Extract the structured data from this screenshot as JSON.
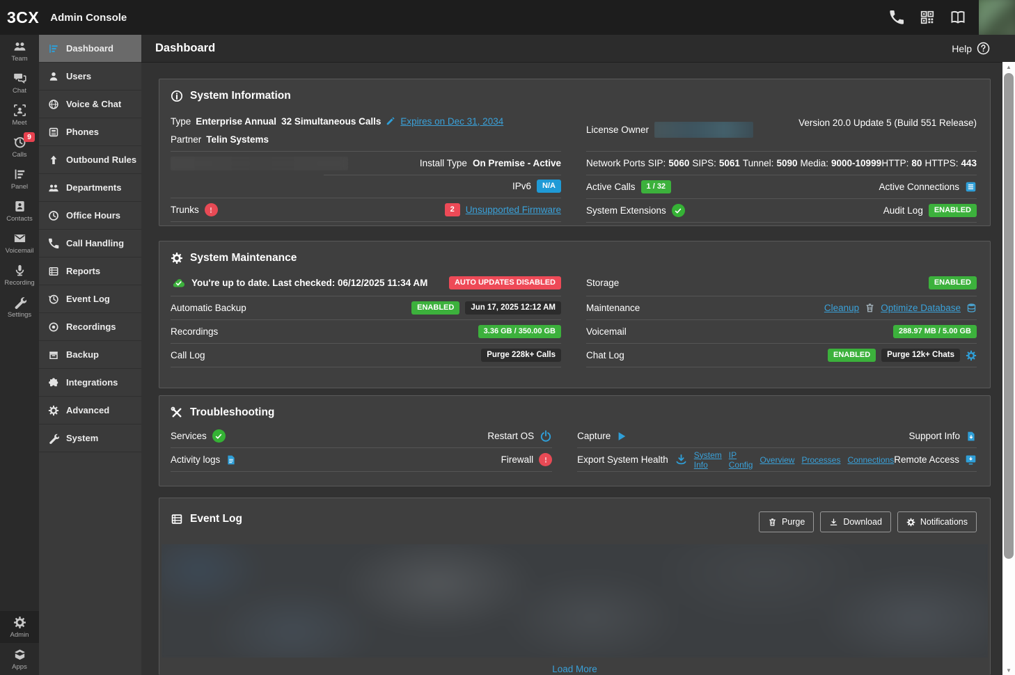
{
  "topbar": {
    "logo": "3CX",
    "title": "Admin Console"
  },
  "header": {
    "title": "Dashboard",
    "help": "Help"
  },
  "rail": {
    "items": [
      {
        "label": "Team"
      },
      {
        "label": "Chat"
      },
      {
        "label": "Meet"
      },
      {
        "label": "Calls",
        "badge": "9"
      },
      {
        "label": "Panel"
      },
      {
        "label": "Contacts"
      },
      {
        "label": "Voicemail"
      },
      {
        "label": "Recording"
      },
      {
        "label": "Settings"
      }
    ],
    "bottom": [
      {
        "label": "Admin"
      },
      {
        "label": "Apps"
      }
    ]
  },
  "sidebar": {
    "items": [
      {
        "label": "Dashboard"
      },
      {
        "label": "Users"
      },
      {
        "label": "Voice & Chat"
      },
      {
        "label": "Phones"
      },
      {
        "label": "Outbound Rules"
      },
      {
        "label": "Departments"
      },
      {
        "label": "Office Hours"
      },
      {
        "label": "Call Handling"
      },
      {
        "label": "Reports"
      },
      {
        "label": "Event Log"
      },
      {
        "label": "Recordings"
      },
      {
        "label": "Backup"
      },
      {
        "label": "Integrations"
      },
      {
        "label": "Advanced"
      },
      {
        "label": "System"
      }
    ]
  },
  "system_info": {
    "title": "System Information",
    "type_label": "Type",
    "type_value": "Enterprise Annual",
    "calls_value": "32 Simultaneous Calls",
    "expires_link": "Expires on Dec 31, 2034",
    "partner_label": "Partner",
    "partner_value": "Telin Systems",
    "install_label": "Install Type",
    "install_value": "On Premise - Active",
    "ipv6_label": "IPv6",
    "ipv6_badge": "N/A",
    "trunks_label": "Trunks",
    "trunks_count": "2",
    "trunks_link": "Unsupported Firmware",
    "license_owner_label": "License Owner",
    "version": "Version 20.0 Update 5 (Build 551 Release)",
    "ports_label": "Network Ports",
    "sip_label": "SIP:",
    "sip_value": "5060",
    "sips_label": "SIPS:",
    "sips_value": "5061",
    "tunnel_label": "Tunnel:",
    "tunnel_value": "5090",
    "media_label": "Media:",
    "media_value": "9000-10999",
    "http_label": "HTTP:",
    "http_value": "80",
    "https_label": "HTTPS:",
    "https_value": "443",
    "active_calls_label": "Active Calls",
    "active_calls_badge": "1 / 32",
    "active_connections_label": "Active Connections",
    "system_extensions_label": "System Extensions",
    "audit_log_label": "Audit Log",
    "audit_log_badge": "ENABLED"
  },
  "system_maintenance": {
    "title": "System Maintenance",
    "update_status": "You're up to date. Last checked: 06/12/2025 11:34 AM",
    "auto_updates_badge": "AUTO UPDATES DISABLED",
    "automatic_backup_label": "Automatic Backup",
    "automatic_backup_badge": "ENABLED",
    "automatic_backup_date": "Jun 17, 2025 12:12 AM",
    "recordings_label": "Recordings",
    "recordings_badge": "3.36 GB / 350.00 GB",
    "call_log_label": "Call Log",
    "call_log_badge": "Purge 228k+ Calls",
    "storage_label": "Storage",
    "storage_badge": "ENABLED",
    "maintenance_label": "Maintenance",
    "cleanup_link": "Cleanup",
    "optimize_link": "Optimize Database",
    "voicemail_label": "Voicemail",
    "voicemail_badge": "288.97 MB / 5.00 GB",
    "chat_log_label": "Chat Log",
    "chat_log_badge": "ENABLED",
    "chat_log_purge": "Purge 12k+ Chats"
  },
  "troubleshooting": {
    "title": "Troubleshooting",
    "services_label": "Services",
    "restart_os_label": "Restart OS",
    "activity_logs_label": "Activity logs",
    "firewall_label": "Firewall",
    "capture_label": "Capture",
    "support_info_label": "Support Info",
    "export_label": "Export System Health",
    "links": [
      {
        "label": "System Info"
      },
      {
        "label": "IP Config"
      },
      {
        "label": "Overview"
      },
      {
        "label": "Processes"
      },
      {
        "label": "Connections"
      }
    ],
    "remote_access_label": "Remote Access"
  },
  "event_log": {
    "title": "Event Log",
    "purge_button": "Purge",
    "download_button": "Download",
    "notifications_button": "Notifications",
    "load_more": "Load More"
  },
  "colors": {
    "accent_blue": "#2f9fd8",
    "link_blue": "#3aa1d9",
    "green": "#3cb13c",
    "red": "#ee4a57",
    "badge_blue": "#1f9ad6"
  }
}
